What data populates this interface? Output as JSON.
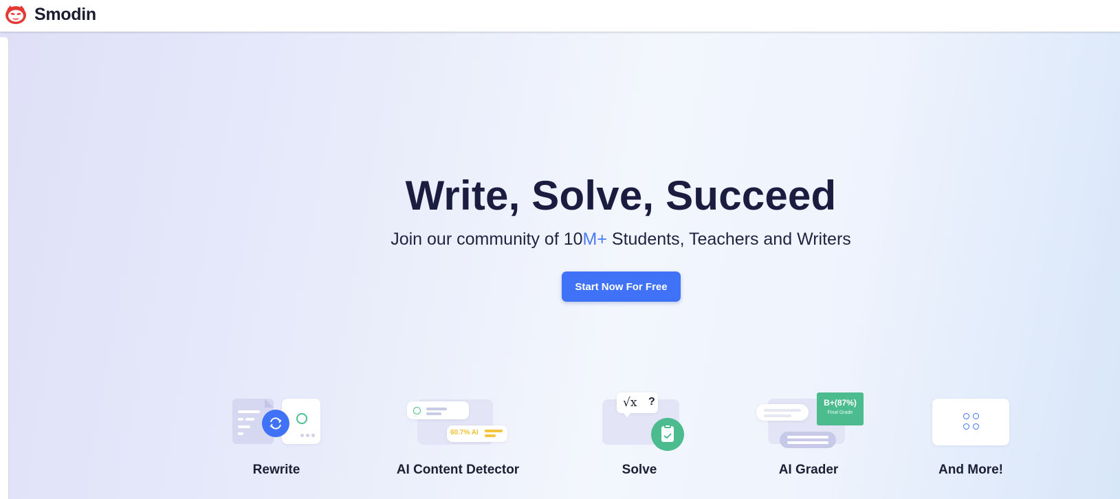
{
  "header": {
    "brand_name": "Smodin",
    "logo_icon": "smodin-mascot-icon",
    "accent_color": "#e53935"
  },
  "hero": {
    "title": "Write, Solve, Succeed",
    "subtitle_prefix": "Join our community of 10",
    "subtitle_accent": "M+",
    "subtitle_suffix": " Students, Teachers and Writers",
    "cta_label": "Start Now For Free",
    "cta_color": "#3f72f6"
  },
  "features": [
    {
      "label": "Rewrite",
      "icon": "rewrite-refresh-icon"
    },
    {
      "label": "AI Content Detector",
      "icon": "ai-detector-icon",
      "badge": "60.7% AI"
    },
    {
      "label": "Solve",
      "icon": "math-solve-icon",
      "formula": "√x",
      "question_mark": "?"
    },
    {
      "label": "AI Grader",
      "icon": "grader-icon",
      "grade": "B+(87%)",
      "grade_caption": "Final Grade"
    },
    {
      "label": "And More!",
      "icon": "more-grid-icon"
    }
  ]
}
